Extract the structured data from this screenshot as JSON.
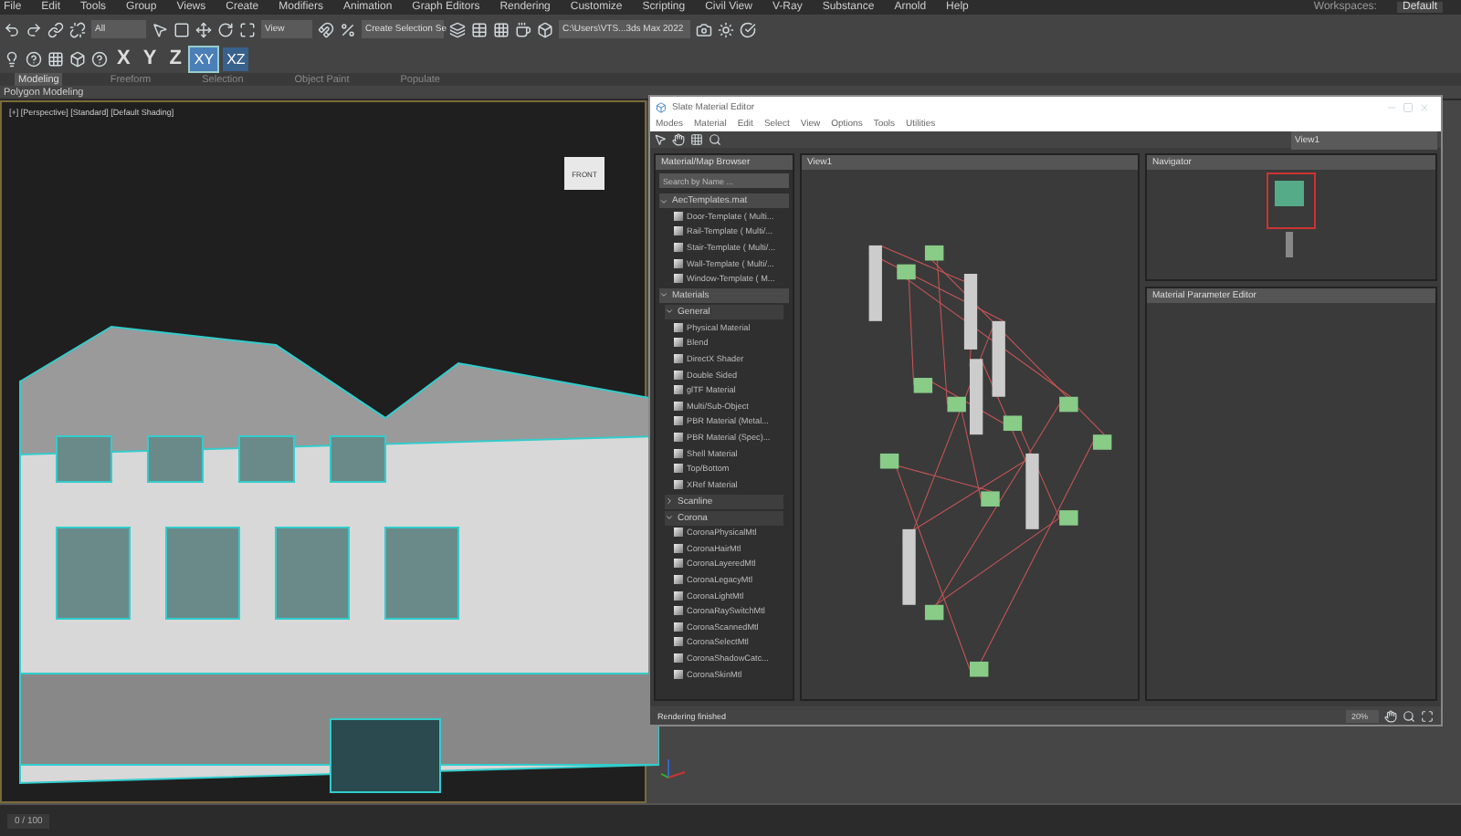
{
  "menu_bar": {
    "items": [
      "File",
      "Edit",
      "Tools",
      "Group",
      "Views",
      "Create",
      "Modifiers",
      "Animation",
      "Graph Editors",
      "Rendering",
      "Customize",
      "Scripting",
      "Civil View",
      "V-Ray",
      "Substance",
      "Arnold",
      "Help"
    ],
    "workspaces_label": "Workspaces:",
    "workspace": "Default"
  },
  "toolbar": {
    "filter": "All",
    "reference": "View",
    "selection_set": "Create Selection Se",
    "project_path": "C:\\Users\\VTS...3ds Max 2022",
    "axis_letters": [
      "X",
      "Y",
      "Z"
    ],
    "planes": [
      {
        "label": "XY",
        "selected": true
      },
      {
        "label": "XZ",
        "selected": false
      }
    ]
  },
  "ribbon": {
    "tabs": [
      {
        "label": "Modeling",
        "selected": true
      },
      {
        "label": "Freeform",
        "selected": false
      },
      {
        "label": "Selection",
        "selected": false
      },
      {
        "label": "Object Paint",
        "selected": false
      },
      {
        "label": "Populate",
        "selected": false
      }
    ],
    "panel": "Polygon Modeling"
  },
  "viewport": {
    "label": "[+] [Perspective] [Standard] [Default Shading]",
    "viewcube": "FRONT"
  },
  "slate_editor": {
    "title": "Slate Material Editor",
    "menu": [
      "Modes",
      "Material",
      "Edit",
      "Select",
      "View",
      "Options",
      "Tools",
      "Utilities"
    ],
    "view_dropdown": "View1",
    "browser": {
      "title": "Material/Map Browser",
      "search_placeholder": "Search by Name ...",
      "groups": [
        {
          "label": "AecTemplates.mat",
          "expanded": true,
          "items": [
            "Door-Template ( Multi...",
            "Rail-Template ( Multi/...",
            "Stair-Template ( Multi/...",
            "Wall-Template ( Multi/...",
            "Window-Template ( M..."
          ]
        },
        {
          "label": "Materials",
          "expanded": true,
          "children": [
            {
              "label": "General",
              "expanded": true,
              "items": [
                "Physical Material",
                "Blend",
                "DirectX Shader",
                "Double Sided",
                "glTF Material",
                "Multi/Sub-Object",
                "PBR Material (Metal...",
                "PBR Material (Spec)...",
                "Shell Material",
                "Top/Bottom",
                "XRef Material"
              ]
            },
            {
              "label": "Scanline",
              "expanded": false
            },
            {
              "label": "Corona",
              "expanded": true,
              "items": [
                "CoronaPhysicalMtl",
                "CoronaHairMtl",
                "CoronaLayeredMtl",
                "CoronaLegacyMtl",
                "CoronaLightMtl",
                "CoronaRaySwitchMtl",
                "CoronaScannedMtl",
                "CoronaSelectMtl",
                "CoronaShadowCatc...",
                "CoronaSkinMtl"
              ]
            }
          ]
        }
      ]
    },
    "view_tab": "View1",
    "navigator_title": "Navigator",
    "parameter_editor_title": "Material Parameter Editor",
    "status": "Rendering finished",
    "zoom": "20%"
  },
  "timeline": {
    "frame": "0 / 100"
  }
}
